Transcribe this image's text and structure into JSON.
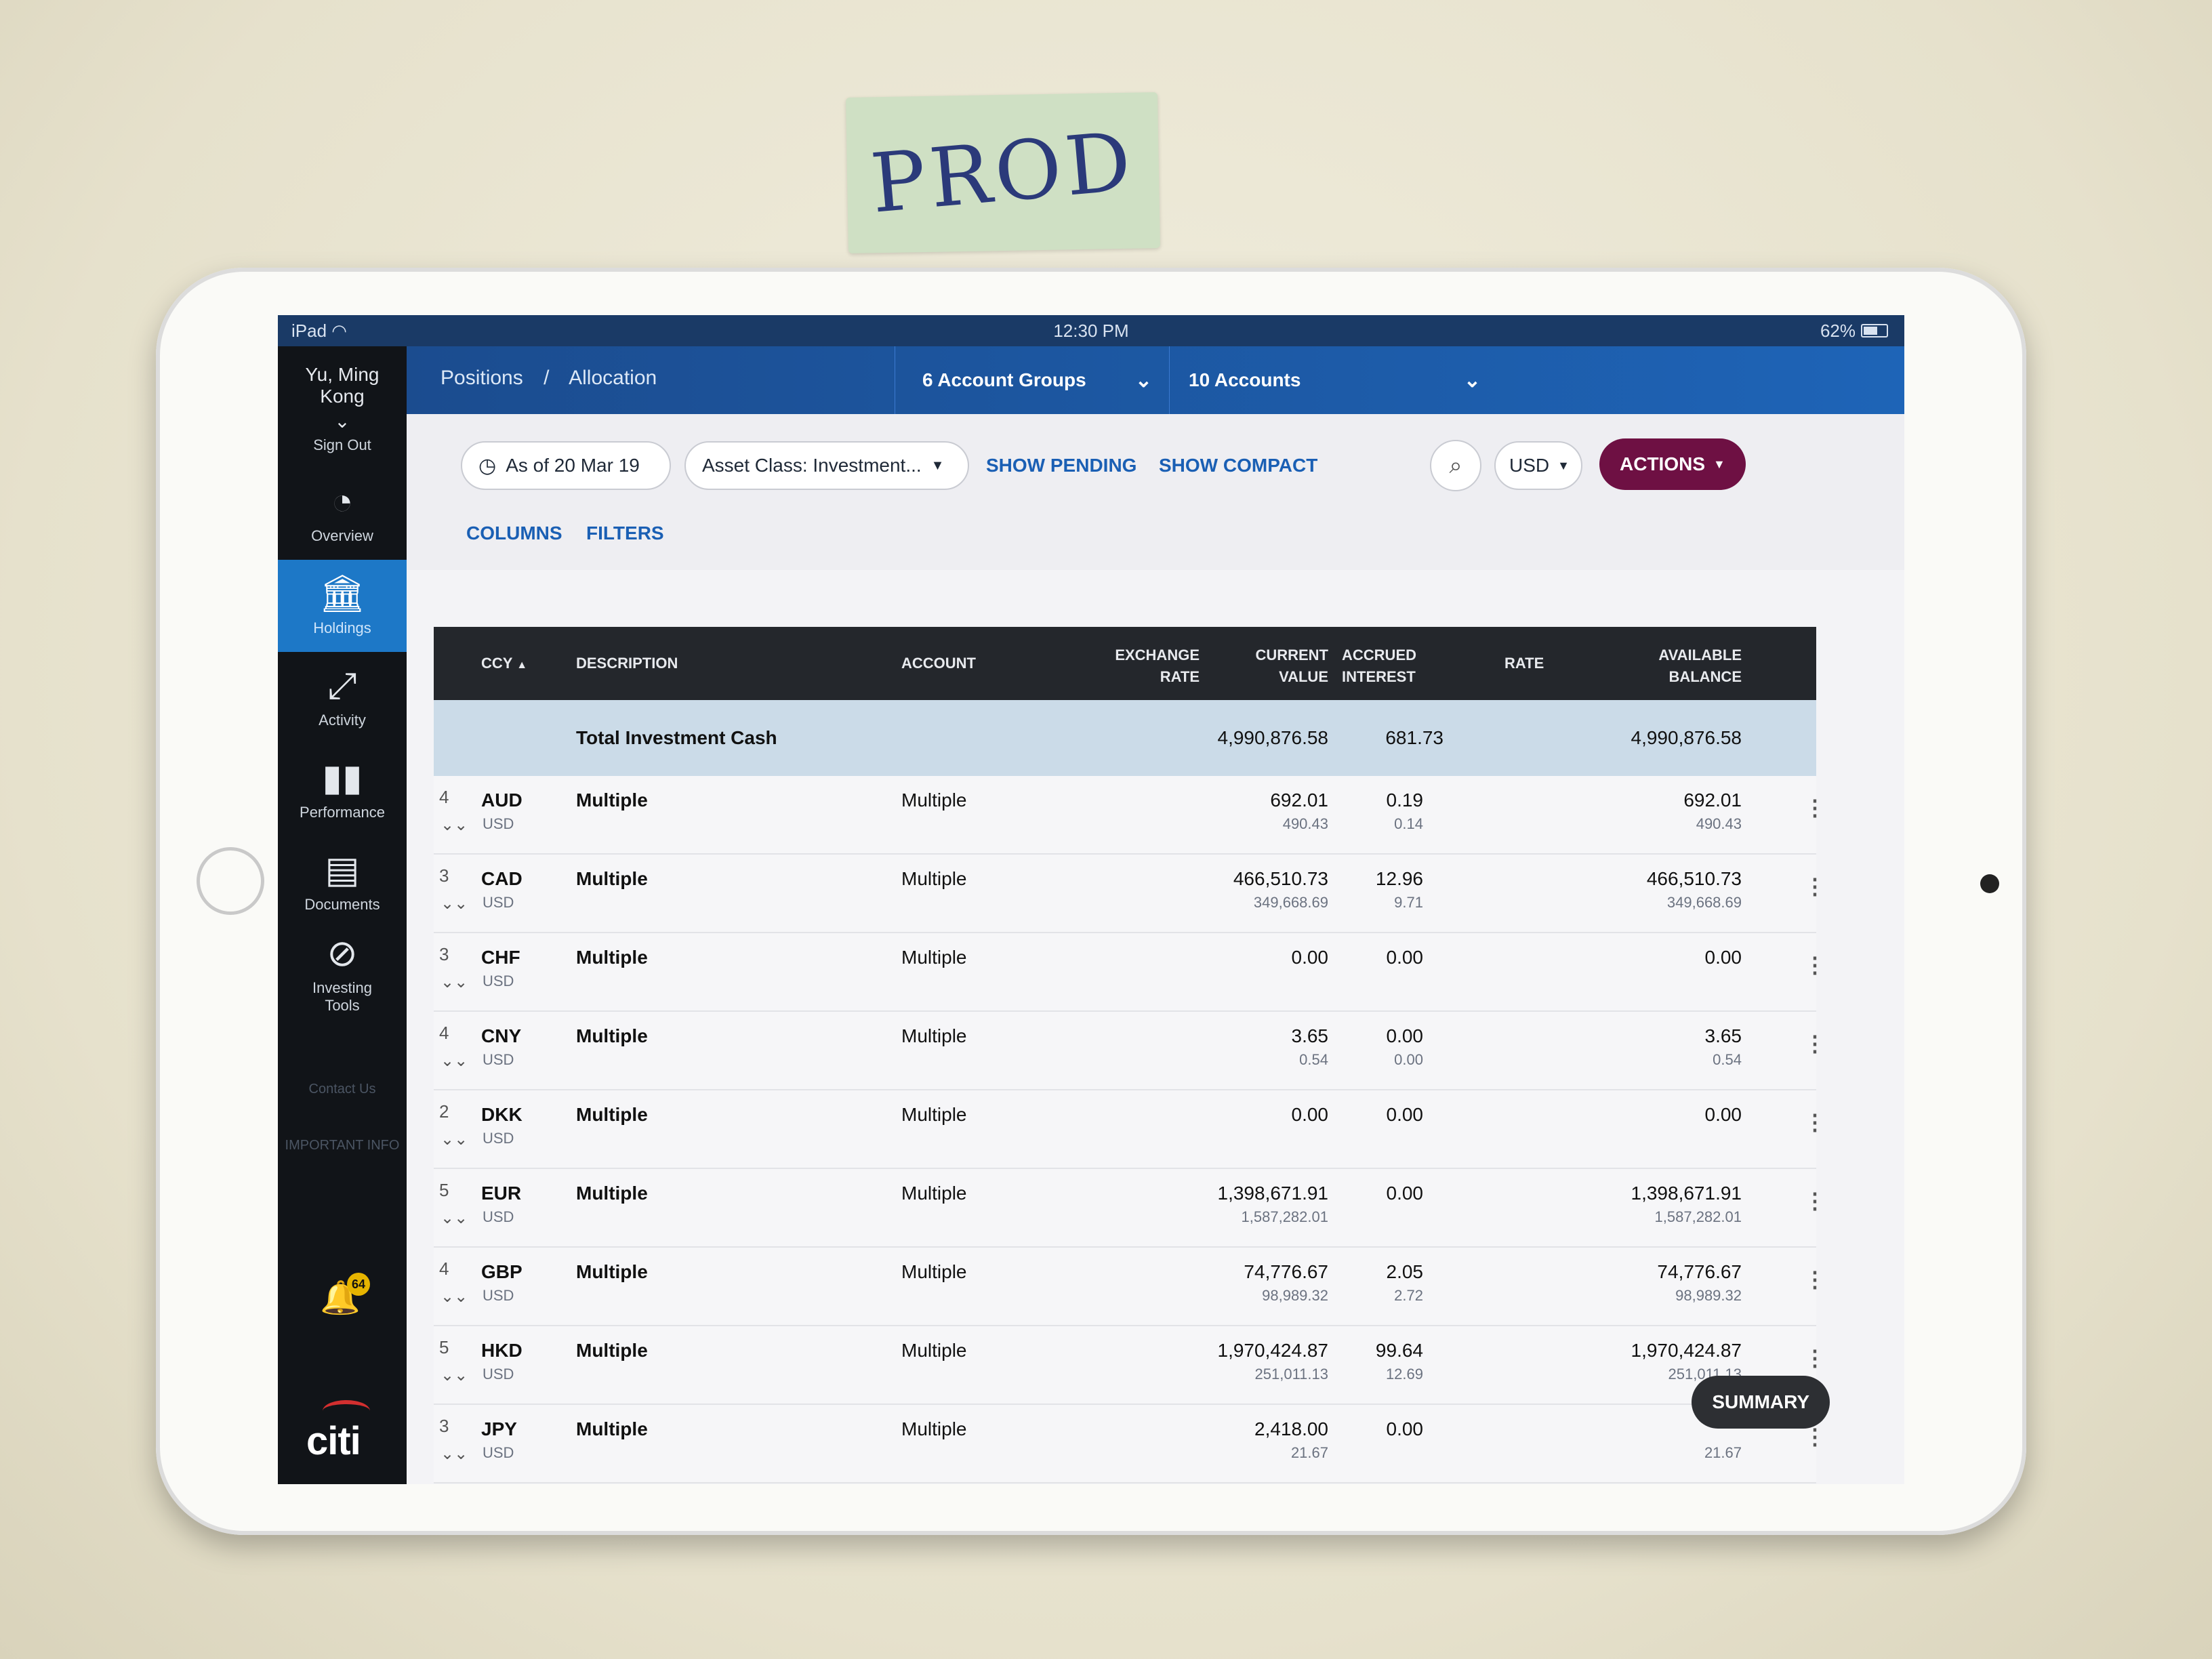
{
  "note_label": "PROD",
  "status_bar": {
    "device": "iPad",
    "time": "12:30 PM",
    "battery": "62%"
  },
  "sidebar": {
    "user_name": "Yu, Ming Kong",
    "sign_out": "Sign Out",
    "items": [
      {
        "label": "Overview",
        "icon": "gauge-icon",
        "active": false
      },
      {
        "label": "Holdings",
        "icon": "bank-icon",
        "active": true
      },
      {
        "label": "Activity",
        "icon": "arrows-icon",
        "active": false
      },
      {
        "label": "Performance",
        "icon": "bar-chart-icon",
        "active": false
      },
      {
        "label": "Documents",
        "icon": "document-lock-icon",
        "active": false
      },
      {
        "label": "Investing Tools",
        "icon": "compass-icon",
        "active": false
      }
    ],
    "contact": "Contact Us",
    "important": "IMPORTANT INFO",
    "notification_count": "64",
    "logo": "citi"
  },
  "header": {
    "breadcrumb": [
      "Positions",
      "Allocation"
    ],
    "account_groups": "6 Account Groups",
    "accounts": "10 Accounts"
  },
  "toolbar": {
    "as_of": "As of 20 Mar 19",
    "asset_class": "Asset Class: Investment...",
    "show_pending": "SHOW PENDING",
    "show_compact": "SHOW COMPACT",
    "currency": "USD",
    "actions": "ACTIONS",
    "columns": "COLUMNS",
    "filters": "FILTERS"
  },
  "table": {
    "columns": {
      "ccy": "CCY",
      "description": "DESCRIPTION",
      "account": "ACCOUNT",
      "exchange_rate_1": "EXCHANGE",
      "exchange_rate_2": "RATE",
      "current_value_1": "CURRENT",
      "current_value_2": "VALUE",
      "accrued_1": "ACCRUED",
      "accrued_2": "INTEREST",
      "rate": "RATE",
      "available_1": "AVAILABLE",
      "available_2": "BALANCE"
    },
    "total": {
      "label": "Total Investment Cash",
      "current_value": "4,990,876.58",
      "accrued": "681.73",
      "available": "4,990,876.58"
    },
    "rows": [
      {
        "count": "4",
        "ccy": "AUD",
        "base": "USD",
        "description": "Multiple",
        "account": "Multiple",
        "value": "692.01",
        "value_usd": "490.43",
        "accrued": "0.19",
        "accrued_usd": "0.14",
        "available": "692.01",
        "available_usd": "490.43"
      },
      {
        "count": "3",
        "ccy": "CAD",
        "base": "USD",
        "description": "Multiple",
        "account": "Multiple",
        "value": "466,510.73",
        "value_usd": "349,668.69",
        "accrued": "12.96",
        "accrued_usd": "9.71",
        "available": "466,510.73",
        "available_usd": "349,668.69"
      },
      {
        "count": "3",
        "ccy": "CHF",
        "base": "USD",
        "description": "Multiple",
        "account": "Multiple",
        "value": "0.00",
        "value_usd": "",
        "accrued": "0.00",
        "accrued_usd": "",
        "available": "0.00",
        "available_usd": ""
      },
      {
        "count": "4",
        "ccy": "CNY",
        "base": "USD",
        "description": "Multiple",
        "account": "Multiple",
        "value": "3.65",
        "value_usd": "0.54",
        "accrued": "0.00",
        "accrued_usd": "0.00",
        "available": "3.65",
        "available_usd": "0.54"
      },
      {
        "count": "2",
        "ccy": "DKK",
        "base": "USD",
        "description": "Multiple",
        "account": "Multiple",
        "value": "0.00",
        "value_usd": "",
        "accrued": "0.00",
        "accrued_usd": "",
        "available": "0.00",
        "available_usd": ""
      },
      {
        "count": "5",
        "ccy": "EUR",
        "base": "USD",
        "description": "Multiple",
        "account": "Multiple",
        "value": "1,398,671.91",
        "value_usd": "1,587,282.01",
        "accrued": "0.00",
        "accrued_usd": "",
        "available": "1,398,671.91",
        "available_usd": "1,587,282.01"
      },
      {
        "count": "4",
        "ccy": "GBP",
        "base": "USD",
        "description": "Multiple",
        "account": "Multiple",
        "value": "74,776.67",
        "value_usd": "98,989.32",
        "accrued": "2.05",
        "accrued_usd": "2.72",
        "available": "74,776.67",
        "available_usd": "98,989.32"
      },
      {
        "count": "5",
        "ccy": "HKD",
        "base": "USD",
        "description": "Multiple",
        "account": "Multiple",
        "value": "1,970,424.87",
        "value_usd": "251,011.13",
        "accrued": "99.64",
        "accrued_usd": "12.69",
        "available": "1,970,424.87",
        "available_usd": "251,011.13"
      },
      {
        "count": "3",
        "ccy": "JPY",
        "base": "USD",
        "description": "Multiple",
        "account": "Multiple",
        "value": "2,418.00",
        "value_usd": "21.67",
        "accrued": "0.00",
        "accrued_usd": "",
        "available": "",
        "available_usd": "21.67"
      }
    ]
  },
  "summary_button": "SUMMARY"
}
